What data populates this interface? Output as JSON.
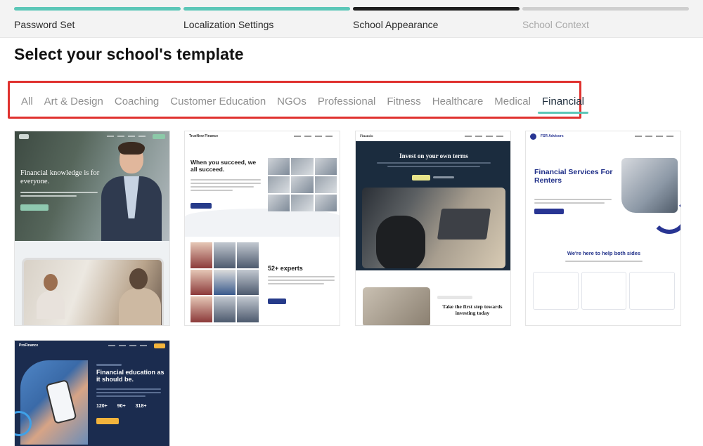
{
  "stepper": {
    "steps": [
      {
        "label": "Password Set",
        "state": "done"
      },
      {
        "label": "Localization Settings",
        "state": "done"
      },
      {
        "label": "School Appearance",
        "state": "current"
      },
      {
        "label": "School Context",
        "state": "todo"
      }
    ]
  },
  "page": {
    "title": "Select your school's template"
  },
  "tabs": {
    "items": [
      "All",
      "Art & Design",
      "Coaching",
      "Customer Education",
      "NGOs",
      "Professional",
      "Fitness",
      "Healthcare",
      "Medical",
      "Financial"
    ],
    "active": "Financial"
  },
  "templates": {
    "t1": {
      "headline": "Financial knowledge is for everyone."
    },
    "t2": {
      "brand": "TrueNew Finance",
      "headline": "When you succeed, we all succeed.",
      "stat": "52+ experts"
    },
    "t3": {
      "brand": "Financio",
      "headline": "Invest on your own terms",
      "subheadline": "Take the first step towards investing today"
    },
    "t4": {
      "brand": "FSR Advisors",
      "headline": "Financial Services For Renters",
      "subheadline": "We're here to help both sides"
    },
    "t5": {
      "brand": "ProFinance",
      "headline": "Financial education as it should be.",
      "stats": [
        "120+",
        "90+",
        "318+"
      ]
    }
  },
  "colors": {
    "accent_teal": "#5cc7b8",
    "highlight_red": "#e0322f",
    "text_dark": "#1d2c3b"
  }
}
